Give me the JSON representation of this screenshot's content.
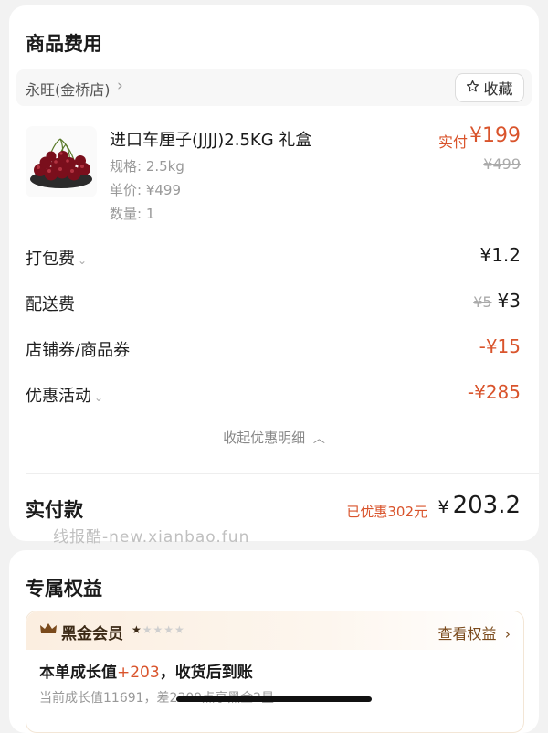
{
  "fees_card": {
    "title": "商品费用",
    "store": {
      "name": "永旺(金桥店)",
      "favorite_label": "收藏"
    },
    "product": {
      "name": "进口车厘子(JJJJ)2.5KG 礼盒",
      "spec": "规格: 2.5kg",
      "unit_price": "单价: ¥499",
      "quantity": "数量: 1",
      "paid_label": "实付",
      "paid_price": "¥199",
      "original_price": "¥499"
    },
    "rows": [
      {
        "label": "打包费",
        "value": "¥1.2"
      },
      {
        "label": "配送费",
        "original": "¥5",
        "value": "¥3"
      },
      {
        "label": "店铺券/商品券",
        "value": "-¥15"
      },
      {
        "label": "优惠活动",
        "value": "-¥285"
      }
    ],
    "collapse_label": "收起优惠明细",
    "total": {
      "label": "实付款",
      "saved": "已优惠302元",
      "currency": "¥",
      "amount": "203.2"
    }
  },
  "watermark": "线报酷-new.xianbao.fun",
  "benefits_card": {
    "title": "专属权益",
    "member": {
      "title": "黑金会员",
      "stars_filled": 1,
      "stars_total": 5,
      "view_label": "查看权益",
      "growth_prefix": "本单成长值",
      "growth_value": "+203",
      "growth_suffix": "，收货后到账",
      "growth_sub": "当前成长值11691，差2309点享黑金2星"
    }
  },
  "colors": {
    "accent_red": "#d9542c",
    "gold_brown": "#7a4a1c"
  }
}
